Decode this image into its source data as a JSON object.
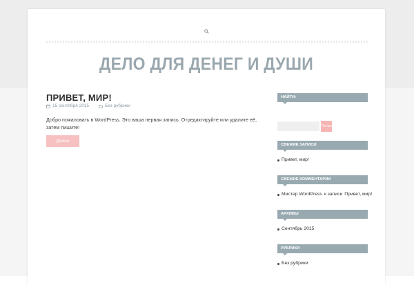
{
  "header": {
    "site_title": "ДЕЛО ДЛЯ ДЕНЕГ И ДУШИ",
    "search_icon": "search-icon"
  },
  "post": {
    "title": "ПРИВЕТ, МИР!",
    "date": "15 сентября 2015",
    "category": "Без рубрики",
    "body": "Добро пожаловать в WordPress. Это ваша первая запись. Отредактируйте или удалите её, затем пишите!",
    "more_label": "Далее",
    "date_icon": "calendar-icon",
    "category_icon": "folder-icon"
  },
  "sidebar": {
    "search": {
      "title": "НАЙТИ:",
      "value": "",
      "button_label": "По иск"
    },
    "recent_posts": {
      "title": "СВЕЖИЕ ЗАПИСИ",
      "items": [
        "Привет, мир!"
      ]
    },
    "recent_comments": {
      "title": "СВЕЖИЕ КОММЕНТАРИИ",
      "author": "Мистер WordPress",
      "connector": "к записи",
      "post": "Привет, мир!"
    },
    "archives": {
      "title": "АРХИВЫ",
      "items": [
        "Сентябрь 2015"
      ]
    },
    "categories": {
      "title": "РУБРИКИ",
      "items": [
        "Без рубрики"
      ]
    }
  },
  "colors": {
    "accent": "#98aab0",
    "button_pink": "#f6c1c0",
    "title_gray": "#9aa7ae"
  }
}
